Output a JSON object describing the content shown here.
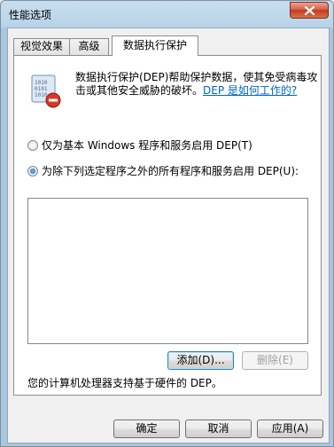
{
  "window": {
    "title": "性能选项"
  },
  "tabs": [
    {
      "label": "视觉效果"
    },
    {
      "label": "高级"
    },
    {
      "label": "数据执行保护"
    }
  ],
  "dep": {
    "description": "数据执行保护(DEP)帮助保护数据，使其免受病毒攻击或其他安全威胁的破坏。",
    "link": "DEP 是如何工作的?",
    "option_basic": "仅为基本 Windows 程序和服务启用 DEP(T)",
    "option_except": "为除下列选定程序之外的所有程序和服务启用 DEP(U):",
    "selected_option": "option_except",
    "add_button": "添加(D)...",
    "remove_button": "删除(E)",
    "hardware_support": "您的计算机处理器支持基于硬件的 DEP。"
  },
  "footer": {
    "ok": "确定",
    "cancel": "取消",
    "apply": "应用(A)"
  }
}
